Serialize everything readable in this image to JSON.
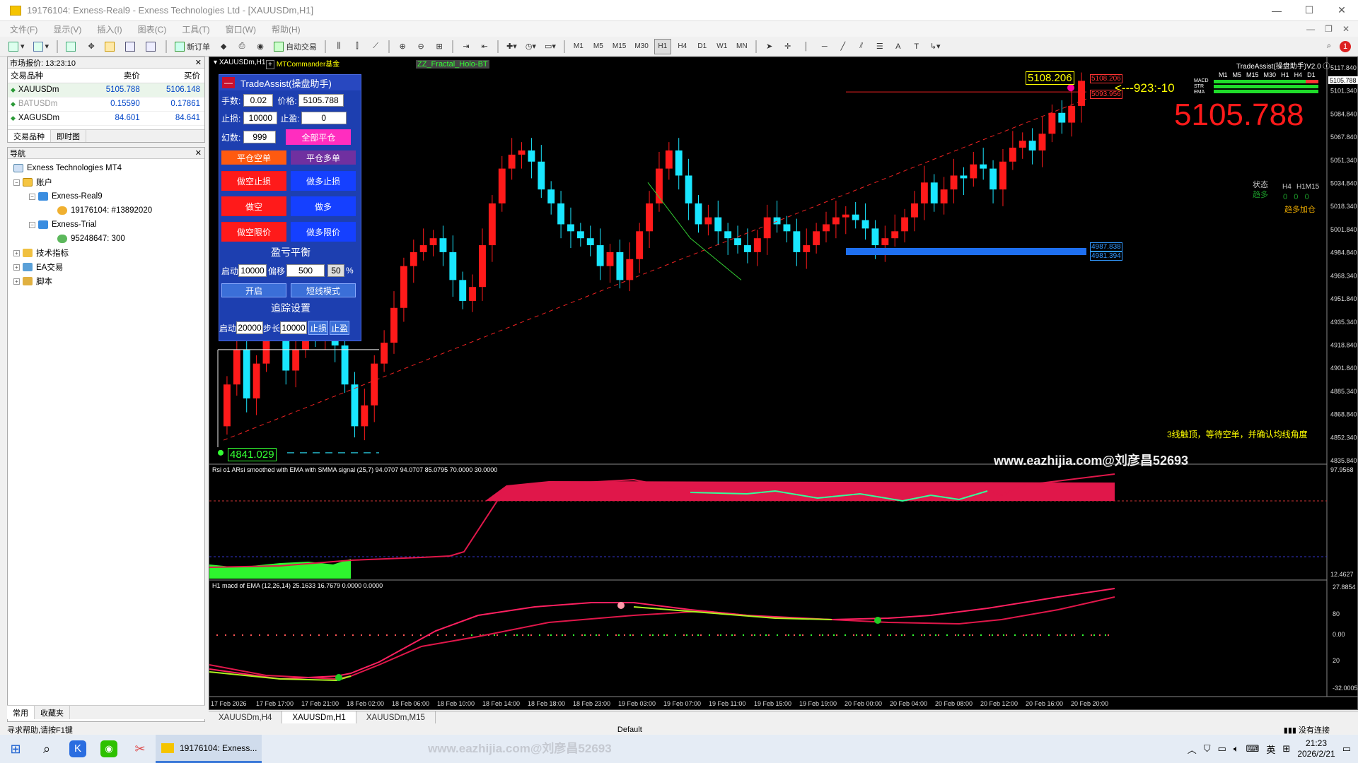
{
  "window": {
    "title": "19176104: Exness-Real9 - Exness Technologies Ltd - [XAUUSDm,H1]",
    "minimize": "—",
    "maximize": "☐",
    "close": "✕"
  },
  "menu": [
    "文件(F)",
    "显示(V)",
    "插入(I)",
    "图表(C)",
    "工具(T)",
    "窗口(W)",
    "帮助(H)"
  ],
  "toolbar": {
    "new_order": "新订单",
    "auto_trading": "自动交易",
    "timeframes": [
      "M1",
      "M5",
      "M15",
      "M30",
      "H1",
      "H4",
      "D1",
      "W1",
      "MN"
    ],
    "active_tf": "H1"
  },
  "market_watch": {
    "title": "市场报价: 13:23:10",
    "col_symbol": "交易品种",
    "col_bid": "卖价",
    "col_ask": "买价",
    "rows": [
      {
        "symbol": "XAUUSDm",
        "bid": "5105.788",
        "ask": "5106.148"
      },
      {
        "symbol": "BATUSDm",
        "bid": "0.15590",
        "ask": "0.17861"
      },
      {
        "symbol": "XAGUSDm",
        "bid": "84.601",
        "ask": "84.641"
      }
    ],
    "tabs": [
      "交易品种",
      "即时图"
    ]
  },
  "navigator": {
    "title": "导航",
    "root": "Exness Technologies MT4",
    "accounts": "账户",
    "real": "Exness-Real9",
    "real_acc": "19176104: #13892020",
    "trial": "Exness-Trial",
    "trial_acc": "95248647: 300",
    "indicators": "技术指标",
    "ea": "EA交易",
    "scripts": "脚本",
    "tabs": [
      "常用",
      "收藏夹"
    ]
  },
  "chart": {
    "symbol_label": "XAUUSDm,H1",
    "commander_label": "MTCommander基金",
    "fractal_label": "ZZ_Fractal_Holo-BT",
    "top_price_tag": "5108.206",
    "red_tag_1": "5108.206",
    "red_tag_2": "5093.956",
    "arrow_label": "<---923:-10",
    "low_tag": "4841.029",
    "blue_tag_1": "4987.838",
    "blue_tag_2": "4981.394",
    "big_price": "5105.788",
    "right_title": "TradeAssist(操盘助手)V2.0",
    "tf_row": [
      "M1",
      "M5",
      "M15",
      "M30",
      "H1",
      "H4",
      "D1"
    ],
    "row_labels": [
      "MACD",
      "STR",
      "EMA"
    ],
    "status_label": "状态",
    "status_value": "趋多",
    "h4_label": "H4",
    "h1m15_label": "H1M15",
    "zeros": "0   0   0",
    "trend_text": "趋多加仓",
    "note": "3线触顶，等待空单，并确认均线角度",
    "watermark": "www.eazhijia.com@刘彦昌52693",
    "price_axis": [
      "5117.840",
      "5101.340",
      "5084.840",
      "5067.840",
      "5051.340",
      "5034.840",
      "5018.340",
      "5001.840",
      "4984.840",
      "4968.340",
      "4951.840",
      "4935.340",
      "4918.840",
      "4901.840",
      "4885.340",
      "4868.840",
      "4852.340",
      "4835.840"
    ],
    "last_price_box": "5105.788",
    "rsi_label": "Rsi o1  ARsi smoothed with EMA with SMMA signal (25,7) 94.0707 94.0707 85.0795 70.0000 30.0000",
    "rsi_axis": [
      "97.9568",
      "12.4627"
    ],
    "macd_label": "H1 macd of EMA (12,26,14) 25.1633 16.7679 0.0000 0.0000",
    "macd_axis": [
      "27.8854",
      "80",
      "0.00",
      "20",
      "-32.0005"
    ],
    "time_axis": [
      "17 Feb 2026",
      "17 Feb 17:00",
      "17 Feb 21:00",
      "18 Feb 02:00",
      "18 Feb 06:00",
      "18 Feb 10:00",
      "18 Feb 14:00",
      "18 Feb 18:00",
      "18 Feb 23:00",
      "19 Feb 03:00",
      "19 Feb 07:00",
      "19 Feb 11:00",
      "19 Feb 15:00",
      "19 Feb 19:00",
      "20 Feb 00:00",
      "20 Feb 04:00",
      "20 Feb 08:00",
      "20 Feb 12:00",
      "20 Feb 16:00",
      "20 Feb 20:00"
    ]
  },
  "trade_assist": {
    "title": "TradeAssist(操盘助手)",
    "min_btn": "—",
    "lots_label": "手数:",
    "lots": "0.02",
    "price_label": "价格:",
    "price": "5105.788",
    "sl_label": "止损:",
    "sl": "10000",
    "tp_label": "止盈:",
    "tp": "0",
    "magic_label": "幻数:",
    "magic": "999",
    "close_all": "全部平仓",
    "close_short": "平仓空单",
    "close_long": "平仓多单",
    "short_sl": "做空止损",
    "long_sl": "做多止损",
    "short": "做空",
    "long": "做多",
    "short_limit": "做空限价",
    "long_limit": "做多限价",
    "balance_title": "盈亏平衡",
    "start_label": "启动",
    "start_val": "10000",
    "offset_label": "偏移",
    "offset_val": "500",
    "pct_val": "50",
    "pct_sign": "%",
    "open_btn": "开启",
    "short_mode": "短线模式",
    "trail_title": "追踪设置",
    "trail_start_label": "启动",
    "trail_start": "20000",
    "step_label": "步长",
    "step_val": "10000",
    "trail_sl": "止损",
    "trail_tp": "止盈"
  },
  "chart_tabs": [
    "XAUUSDm,H4",
    "XAUUSDm,H1",
    "XAUUSDm,M15"
  ],
  "status_bar": {
    "help": "寻求帮助,请按F1键",
    "profile": "Default",
    "conn": "没有连接"
  },
  "taskbar": {
    "app_label": "19176104: Exness...",
    "ime": "英",
    "time": "21:23",
    "date": "2026/2/21",
    "watermark": "www.eazhijia.com@刘彦昌52693"
  },
  "colors": {
    "bull": "#ff1a1a",
    "bear": "#19e6ff",
    "ta_blue": "#1d3fb0",
    "accent": "#ff00a0"
  }
}
